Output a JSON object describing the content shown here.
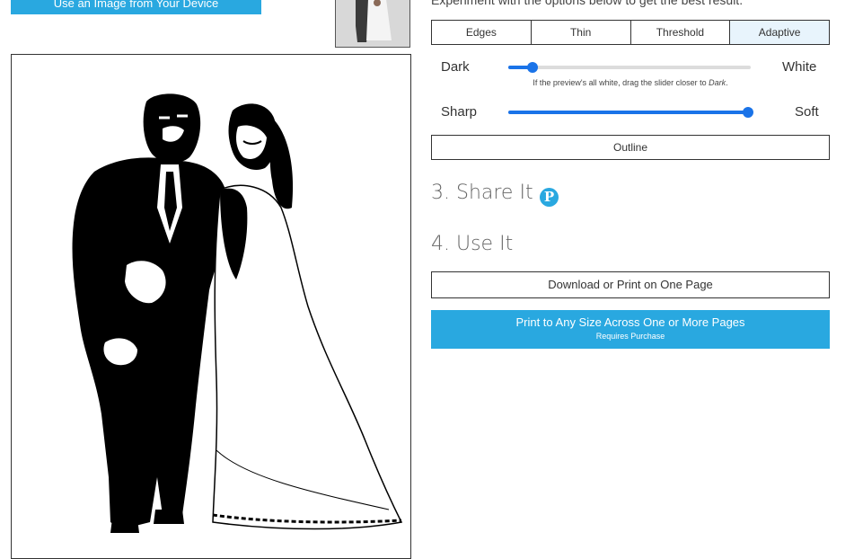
{
  "header": {
    "upload_label": "Use an Image from Your Device",
    "intro_text": "Experiment with the options below to get the best result."
  },
  "modes": {
    "items": [
      "Edges",
      "Thin",
      "Threshold",
      "Adaptive"
    ],
    "active": "Adaptive"
  },
  "sliders": {
    "tone": {
      "left_label": "Dark",
      "right_label": "White",
      "value": 0.1
    },
    "hint_prefix": "If the preview's all white, drag the slider closer to ",
    "hint_emphasis": "Dark",
    "hint_suffix": ".",
    "sharpness": {
      "left_label": "Sharp",
      "right_label": "Soft",
      "value": 0.99
    }
  },
  "outline_label": "Outline",
  "share": {
    "title": "3. Share It",
    "pinterest_glyph": "P"
  },
  "use": {
    "title": "4. Use It",
    "download_label": "Download or Print on One Page",
    "print_label": "Print to Any Size Across One or More Pages",
    "print_sublabel": "Requires Purchase"
  },
  "colors": {
    "accent": "#29a8e0",
    "slider": "#1a73e8"
  }
}
